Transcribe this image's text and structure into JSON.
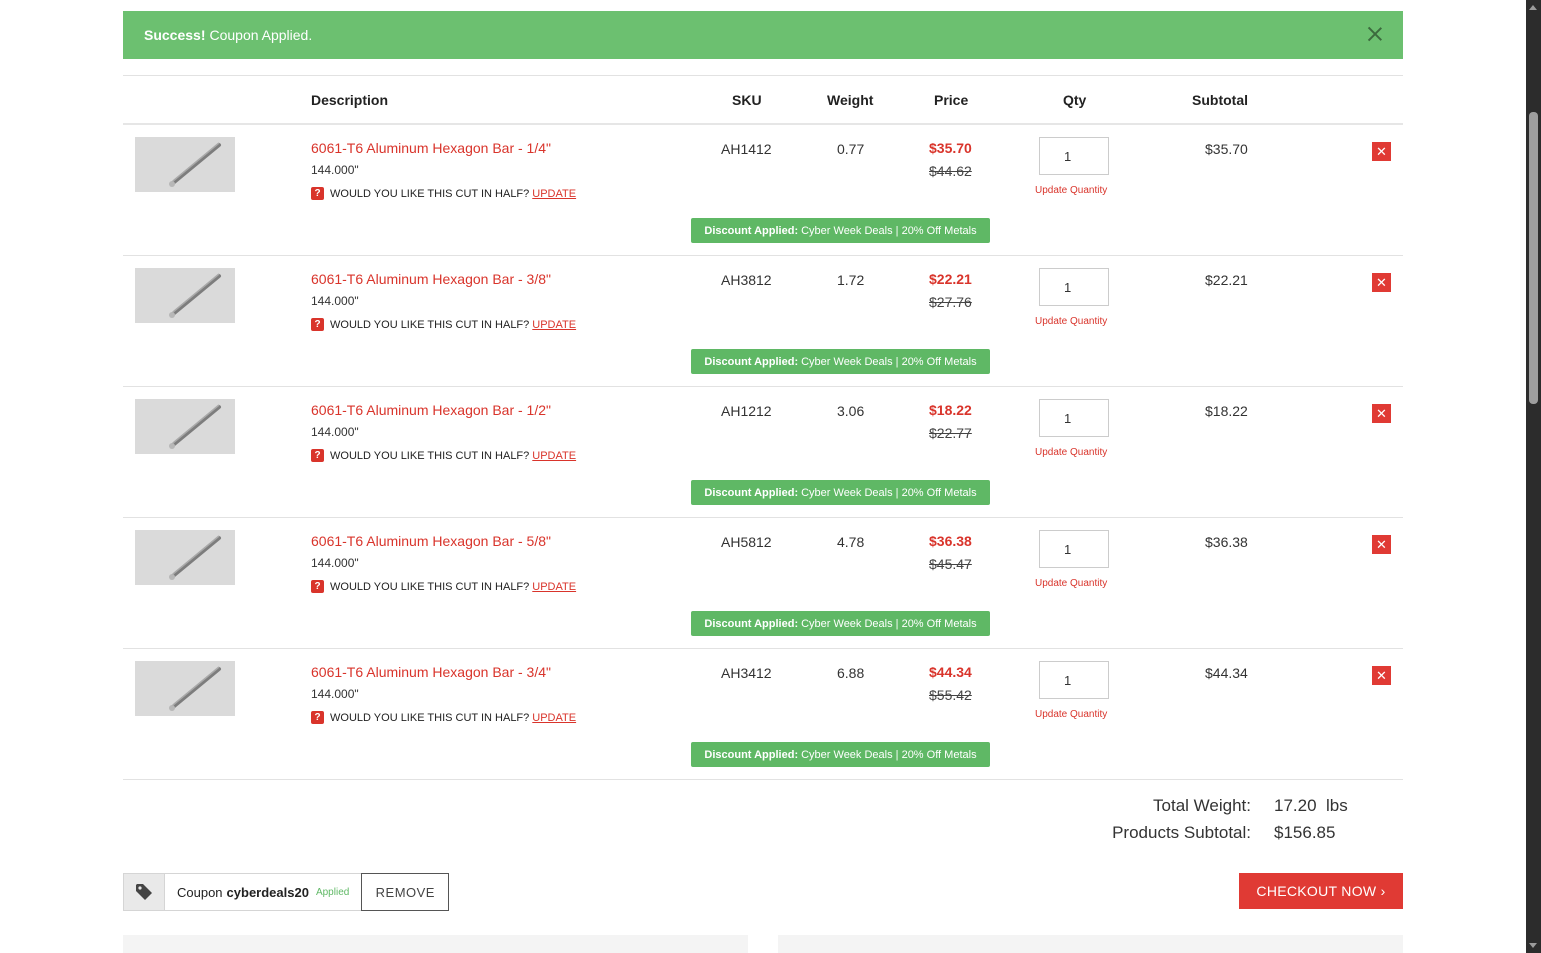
{
  "alert": {
    "strong": "Success!",
    "message": "Coupon Applied."
  },
  "columns": {
    "description": "Description",
    "sku": "SKU",
    "weight": "Weight",
    "price": "Price",
    "qty": "Qty",
    "subtotal": "Subtotal"
  },
  "labels": {
    "cut_question": "WOULD YOU LIKE THIS CUT IN HALF?",
    "cut_update": "UPDATE",
    "update_quantity": "Update Quantity",
    "discount_strong": "Discount Applied:",
    "discount_text": "Cyber Week Deals | 20% Off Metals"
  },
  "items": [
    {
      "name": "6061-T6 Aluminum Hexagon Bar - 1/4\"",
      "length": "144.000\"",
      "sku": "AH1412",
      "weight": "0.77",
      "price": "$35.70",
      "old_price": "$44.62",
      "qty": "1",
      "subtotal": "$35.70"
    },
    {
      "name": "6061-T6 Aluminum Hexagon Bar - 3/8\"",
      "length": "144.000\"",
      "sku": "AH3812",
      "weight": "1.72",
      "price": "$22.21",
      "old_price": "$27.76",
      "qty": "1",
      "subtotal": "$22.21"
    },
    {
      "name": "6061-T6 Aluminum Hexagon Bar - 1/2\"",
      "length": "144.000\"",
      "sku": "AH1212",
      "weight": "3.06",
      "price": "$18.22",
      "old_price": "$22.77",
      "qty": "1",
      "subtotal": "$18.22"
    },
    {
      "name": "6061-T6 Aluminum Hexagon Bar - 5/8\"",
      "length": "144.000\"",
      "sku": "AH5812",
      "weight": "4.78",
      "price": "$36.38",
      "old_price": "$45.47",
      "qty": "1",
      "subtotal": "$36.38"
    },
    {
      "name": "6061-T6 Aluminum Hexagon Bar - 3/4\"",
      "length": "144.000\"",
      "sku": "AH3412",
      "weight": "6.88",
      "price": "$44.34",
      "old_price": "$55.42",
      "qty": "1",
      "subtotal": "$44.34"
    }
  ],
  "totals": {
    "weight_label": "Total Weight:",
    "weight_value": "17.20  lbs",
    "subtotal_label": "Products Subtotal:",
    "subtotal_value": "$156.85"
  },
  "coupon": {
    "prefix": "Coupon",
    "code": "cyberdeals20",
    "status": "Applied",
    "remove": "REMOVE"
  },
  "checkout": {
    "label": "CHECKOUT NOW ›"
  },
  "icons": {
    "alert_close": "close-icon",
    "coupon_tag": "tag-icon",
    "remove_item": "close-icon",
    "cut_help": "question-icon"
  },
  "colors": {
    "success": "#6cc070",
    "accent": "#d9342b",
    "discount": "#5fb865",
    "checkout": "#e03a34"
  }
}
